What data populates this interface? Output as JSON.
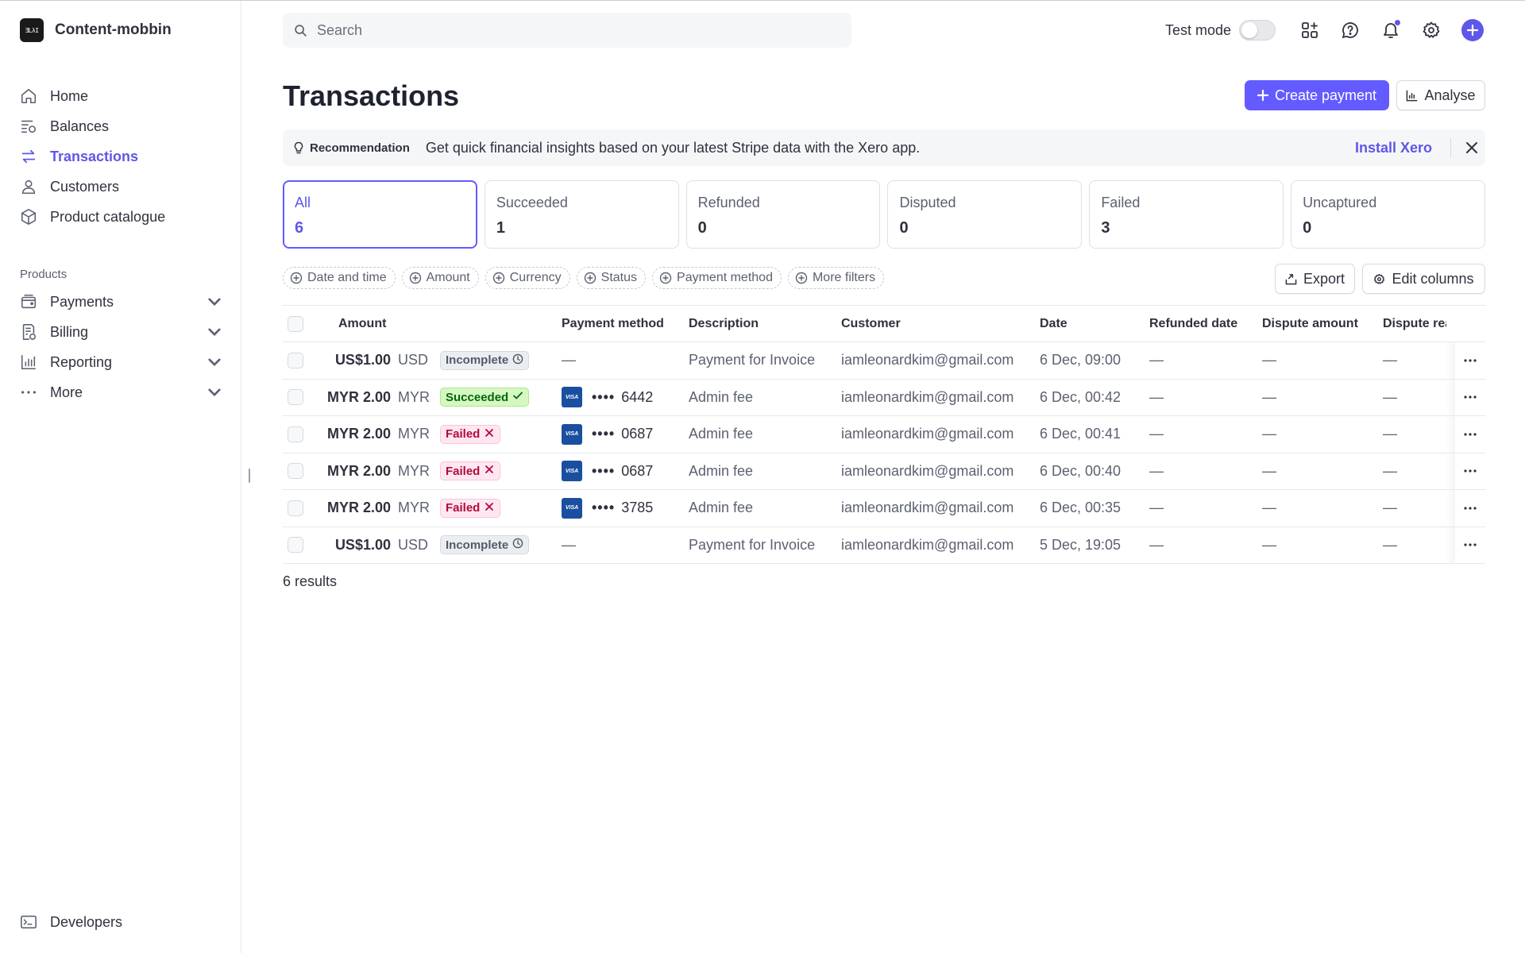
{
  "brand": {
    "logo_text": "ƎLλI",
    "name": "Content-mobbin"
  },
  "nav": {
    "items": [
      {
        "label": "Home",
        "icon": "home-icon"
      },
      {
        "label": "Balances",
        "icon": "balances-icon"
      },
      {
        "label": "Transactions",
        "icon": "transactions-icon",
        "active": true
      },
      {
        "label": "Customers",
        "icon": "customers-icon"
      },
      {
        "label": "Product catalogue",
        "icon": "product-catalogue-icon"
      }
    ],
    "section_label": "Products",
    "product_items": [
      {
        "label": "Payments",
        "icon": "payments-icon"
      },
      {
        "label": "Billing",
        "icon": "billing-icon"
      },
      {
        "label": "Reporting",
        "icon": "reporting-icon"
      },
      {
        "label": "More",
        "icon": "more-dots-icon"
      }
    ],
    "developers_label": "Developers"
  },
  "search": {
    "placeholder": "Search"
  },
  "topbar": {
    "test_mode_label": "Test mode",
    "test_mode_on": false
  },
  "page": {
    "title": "Transactions",
    "create_payment_label": "Create payment",
    "analyse_label": "Analyse"
  },
  "recommendation": {
    "label": "Recommendation",
    "text": "Get quick financial insights based on your latest Stripe data with the Xero app.",
    "link": "Install Xero"
  },
  "status_cards": [
    {
      "label": "All",
      "count": "6",
      "active": true
    },
    {
      "label": "Succeeded",
      "count": "1"
    },
    {
      "label": "Refunded",
      "count": "0"
    },
    {
      "label": "Disputed",
      "count": "0"
    },
    {
      "label": "Failed",
      "count": "3"
    },
    {
      "label": "Uncaptured",
      "count": "0"
    }
  ],
  "filters": [
    "Date and time",
    "Amount",
    "Currency",
    "Status",
    "Payment method",
    "More filters"
  ],
  "actions": {
    "export_label": "Export",
    "edit_columns_label": "Edit columns"
  },
  "table": {
    "headers": {
      "amount": "Amount",
      "payment_method": "Payment method",
      "description": "Description",
      "customer": "Customer",
      "date": "Date",
      "refunded_date": "Refunded date",
      "dispute_amount": "Dispute amount",
      "dispute_reason": "Dispute rea"
    },
    "rows": [
      {
        "amount": "US$1.00",
        "currency": "USD",
        "status": "Incomplete",
        "pm_last4": "",
        "pm_dash": "—",
        "description": "Payment for Invoice",
        "customer": "iamleonardkim@gmail.com",
        "date": "6 Dec, 09:00",
        "refunded_date": "—",
        "dispute_amount": "—",
        "dispute_reason": "—"
      },
      {
        "amount": "MYR 2.00",
        "currency": "MYR",
        "status": "Succeeded",
        "pm_last4": "6442",
        "pm_dash": "",
        "description": "Admin fee",
        "customer": "iamleonardkim@gmail.com",
        "date": "6 Dec, 00:42",
        "refunded_date": "—",
        "dispute_amount": "—",
        "dispute_reason": "—"
      },
      {
        "amount": "MYR 2.00",
        "currency": "MYR",
        "status": "Failed",
        "pm_last4": "0687",
        "pm_dash": "",
        "description": "Admin fee",
        "customer": "iamleonardkim@gmail.com",
        "date": "6 Dec, 00:41",
        "refunded_date": "—",
        "dispute_amount": "—",
        "dispute_reason": "—"
      },
      {
        "amount": "MYR 2.00",
        "currency": "MYR",
        "status": "Failed",
        "pm_last4": "0687",
        "pm_dash": "",
        "description": "Admin fee",
        "customer": "iamleonardkim@gmail.com",
        "date": "6 Dec, 00:40",
        "refunded_date": "—",
        "dispute_amount": "—",
        "dispute_reason": "—"
      },
      {
        "amount": "MYR 2.00",
        "currency": "MYR",
        "status": "Failed",
        "pm_last4": "3785",
        "pm_dash": "",
        "description": "Admin fee",
        "customer": "iamleonardkim@gmail.com",
        "date": "6 Dec, 00:35",
        "refunded_date": "—",
        "dispute_amount": "—",
        "dispute_reason": "—"
      },
      {
        "amount": "US$1.00",
        "currency": "USD",
        "status": "Incomplete",
        "pm_last4": "",
        "pm_dash": "—",
        "description": "Payment for Invoice",
        "customer": "iamleonardkim@gmail.com",
        "date": "5 Dec, 19:05",
        "refunded_date": "—",
        "dispute_amount": "—",
        "dispute_reason": "—"
      }
    ],
    "card_brand": "VISA",
    "card_mask": "••••",
    "results": "6 results"
  },
  "colors": {
    "accent": "#635bff",
    "text": "#30313d",
    "muted": "#5c6170"
  }
}
